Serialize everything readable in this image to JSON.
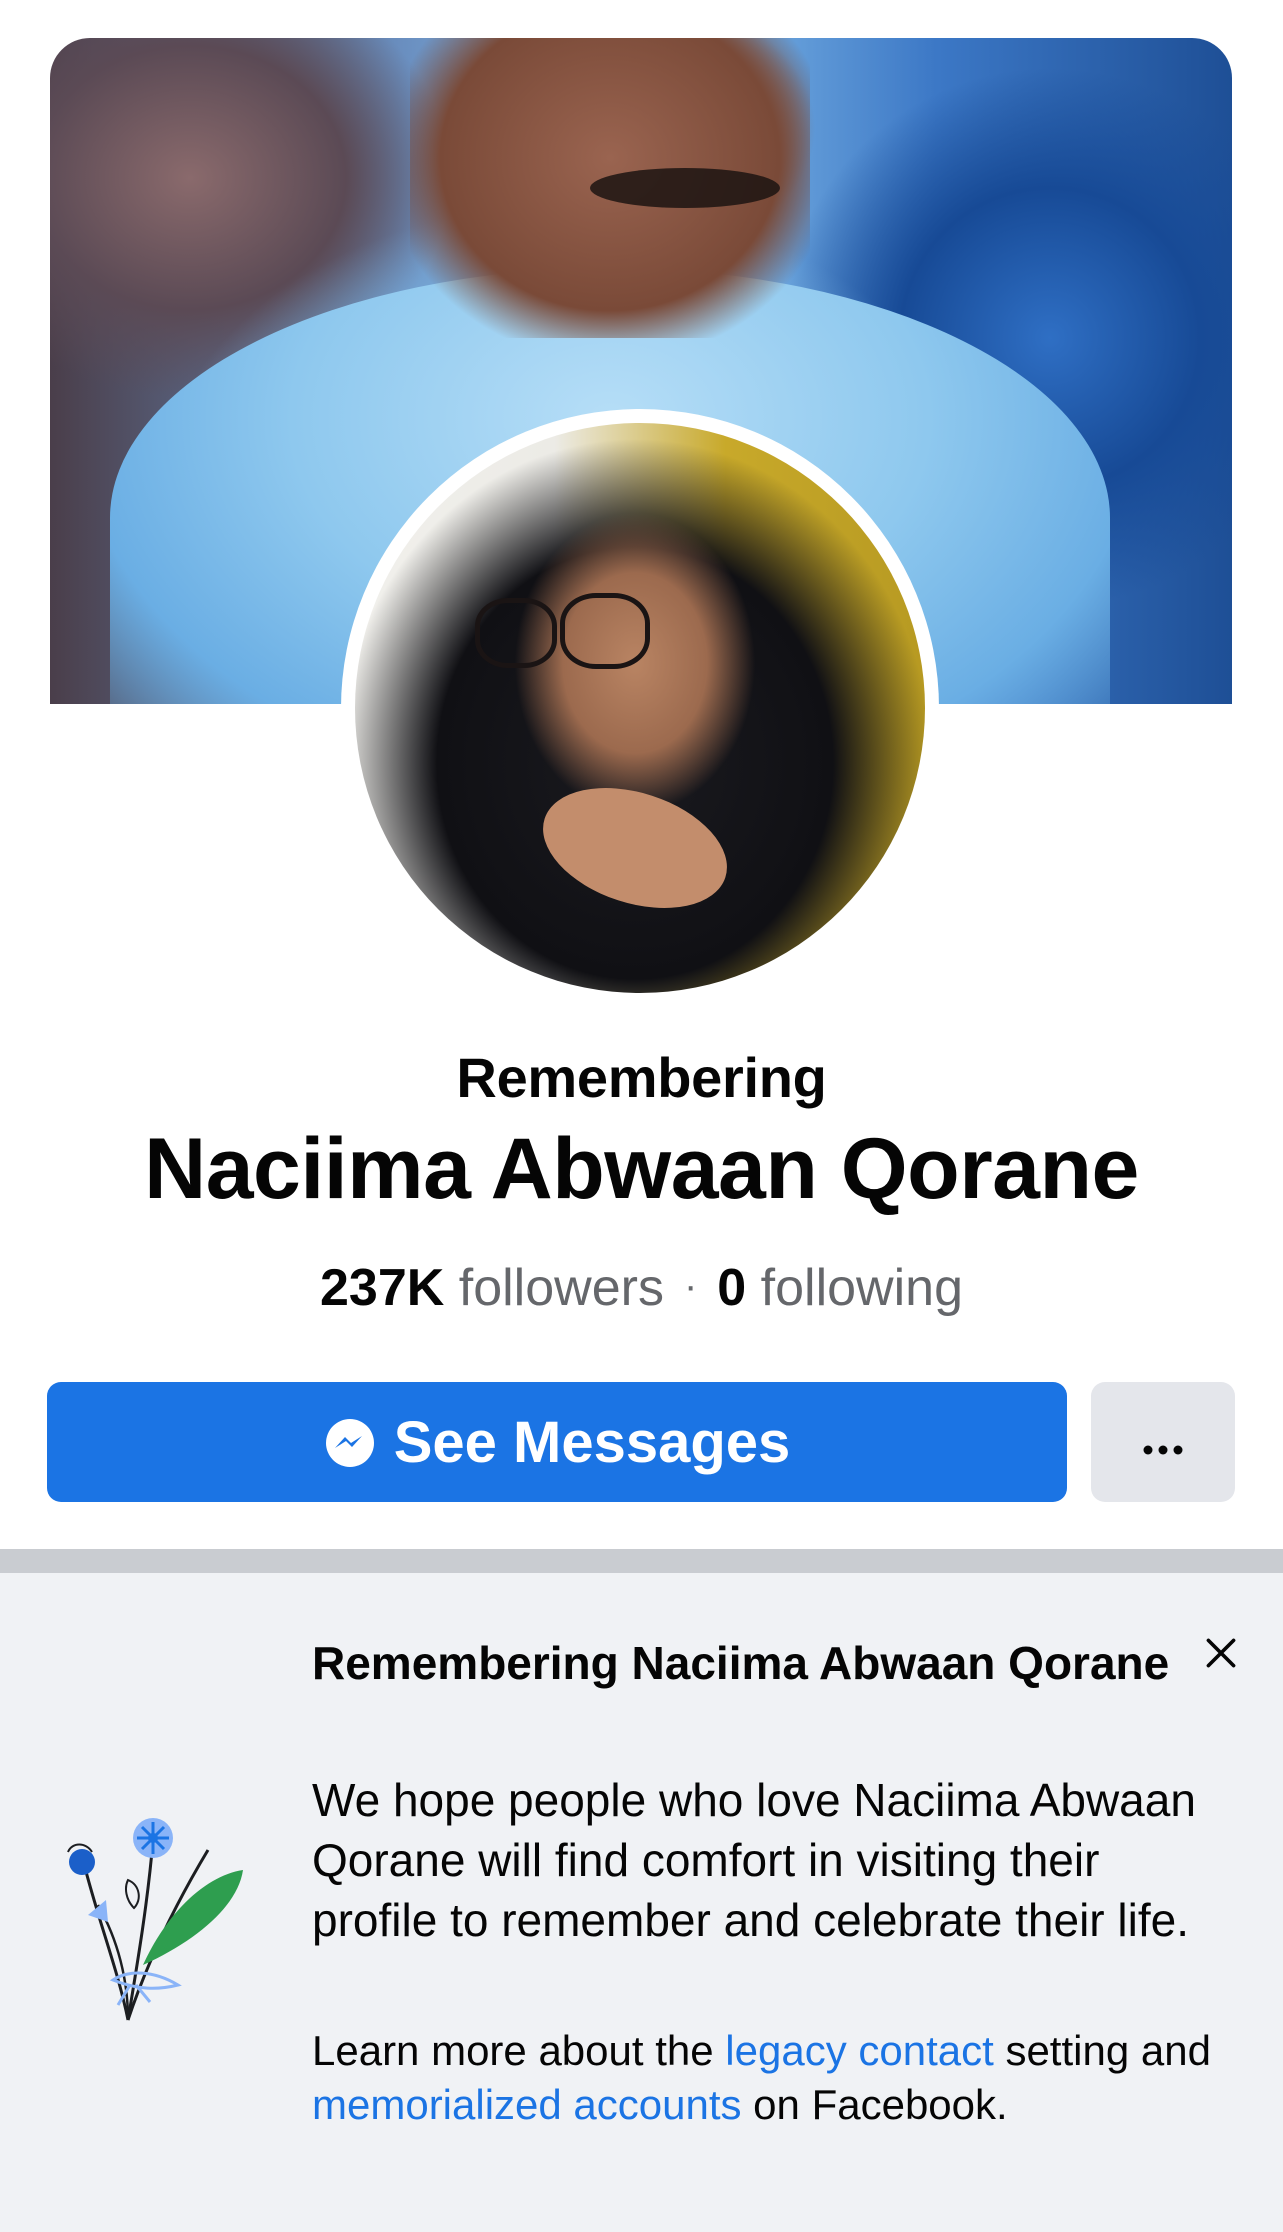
{
  "profile": {
    "remembering_label": "Remembering",
    "name": "Naciima Abwaan Qorane",
    "followers_count": "237K",
    "followers_label": "followers",
    "separator": "·",
    "following_count": "0",
    "following_label": "following"
  },
  "actions": {
    "messages_label": "See Messages",
    "messages_icon": "messenger-icon",
    "more_label": "···",
    "more_icon": "more-dots-icon"
  },
  "memorial": {
    "title": "Remembering Naciima Abwaan Qorane",
    "body": "We hope people who love Naciima Abwaan Qorane will find comfort in visiting their profile to remember and celebrate their life.",
    "learn_prefix": "Learn more about the ",
    "legacy_link": "legacy contact",
    "learn_middle": " setting and ",
    "memorial_link": "memorialized accounts",
    "learn_suffix": " on Facebook.",
    "close_icon": "close-icon",
    "illustration": "flower-bouquet-illustration"
  },
  "colors": {
    "primary_blue": "#1b74e4",
    "secondary_button": "#e4e6eb",
    "card_background": "#f0f2f5",
    "divider": "#c9ccd1",
    "secondary_text": "#65676b"
  }
}
